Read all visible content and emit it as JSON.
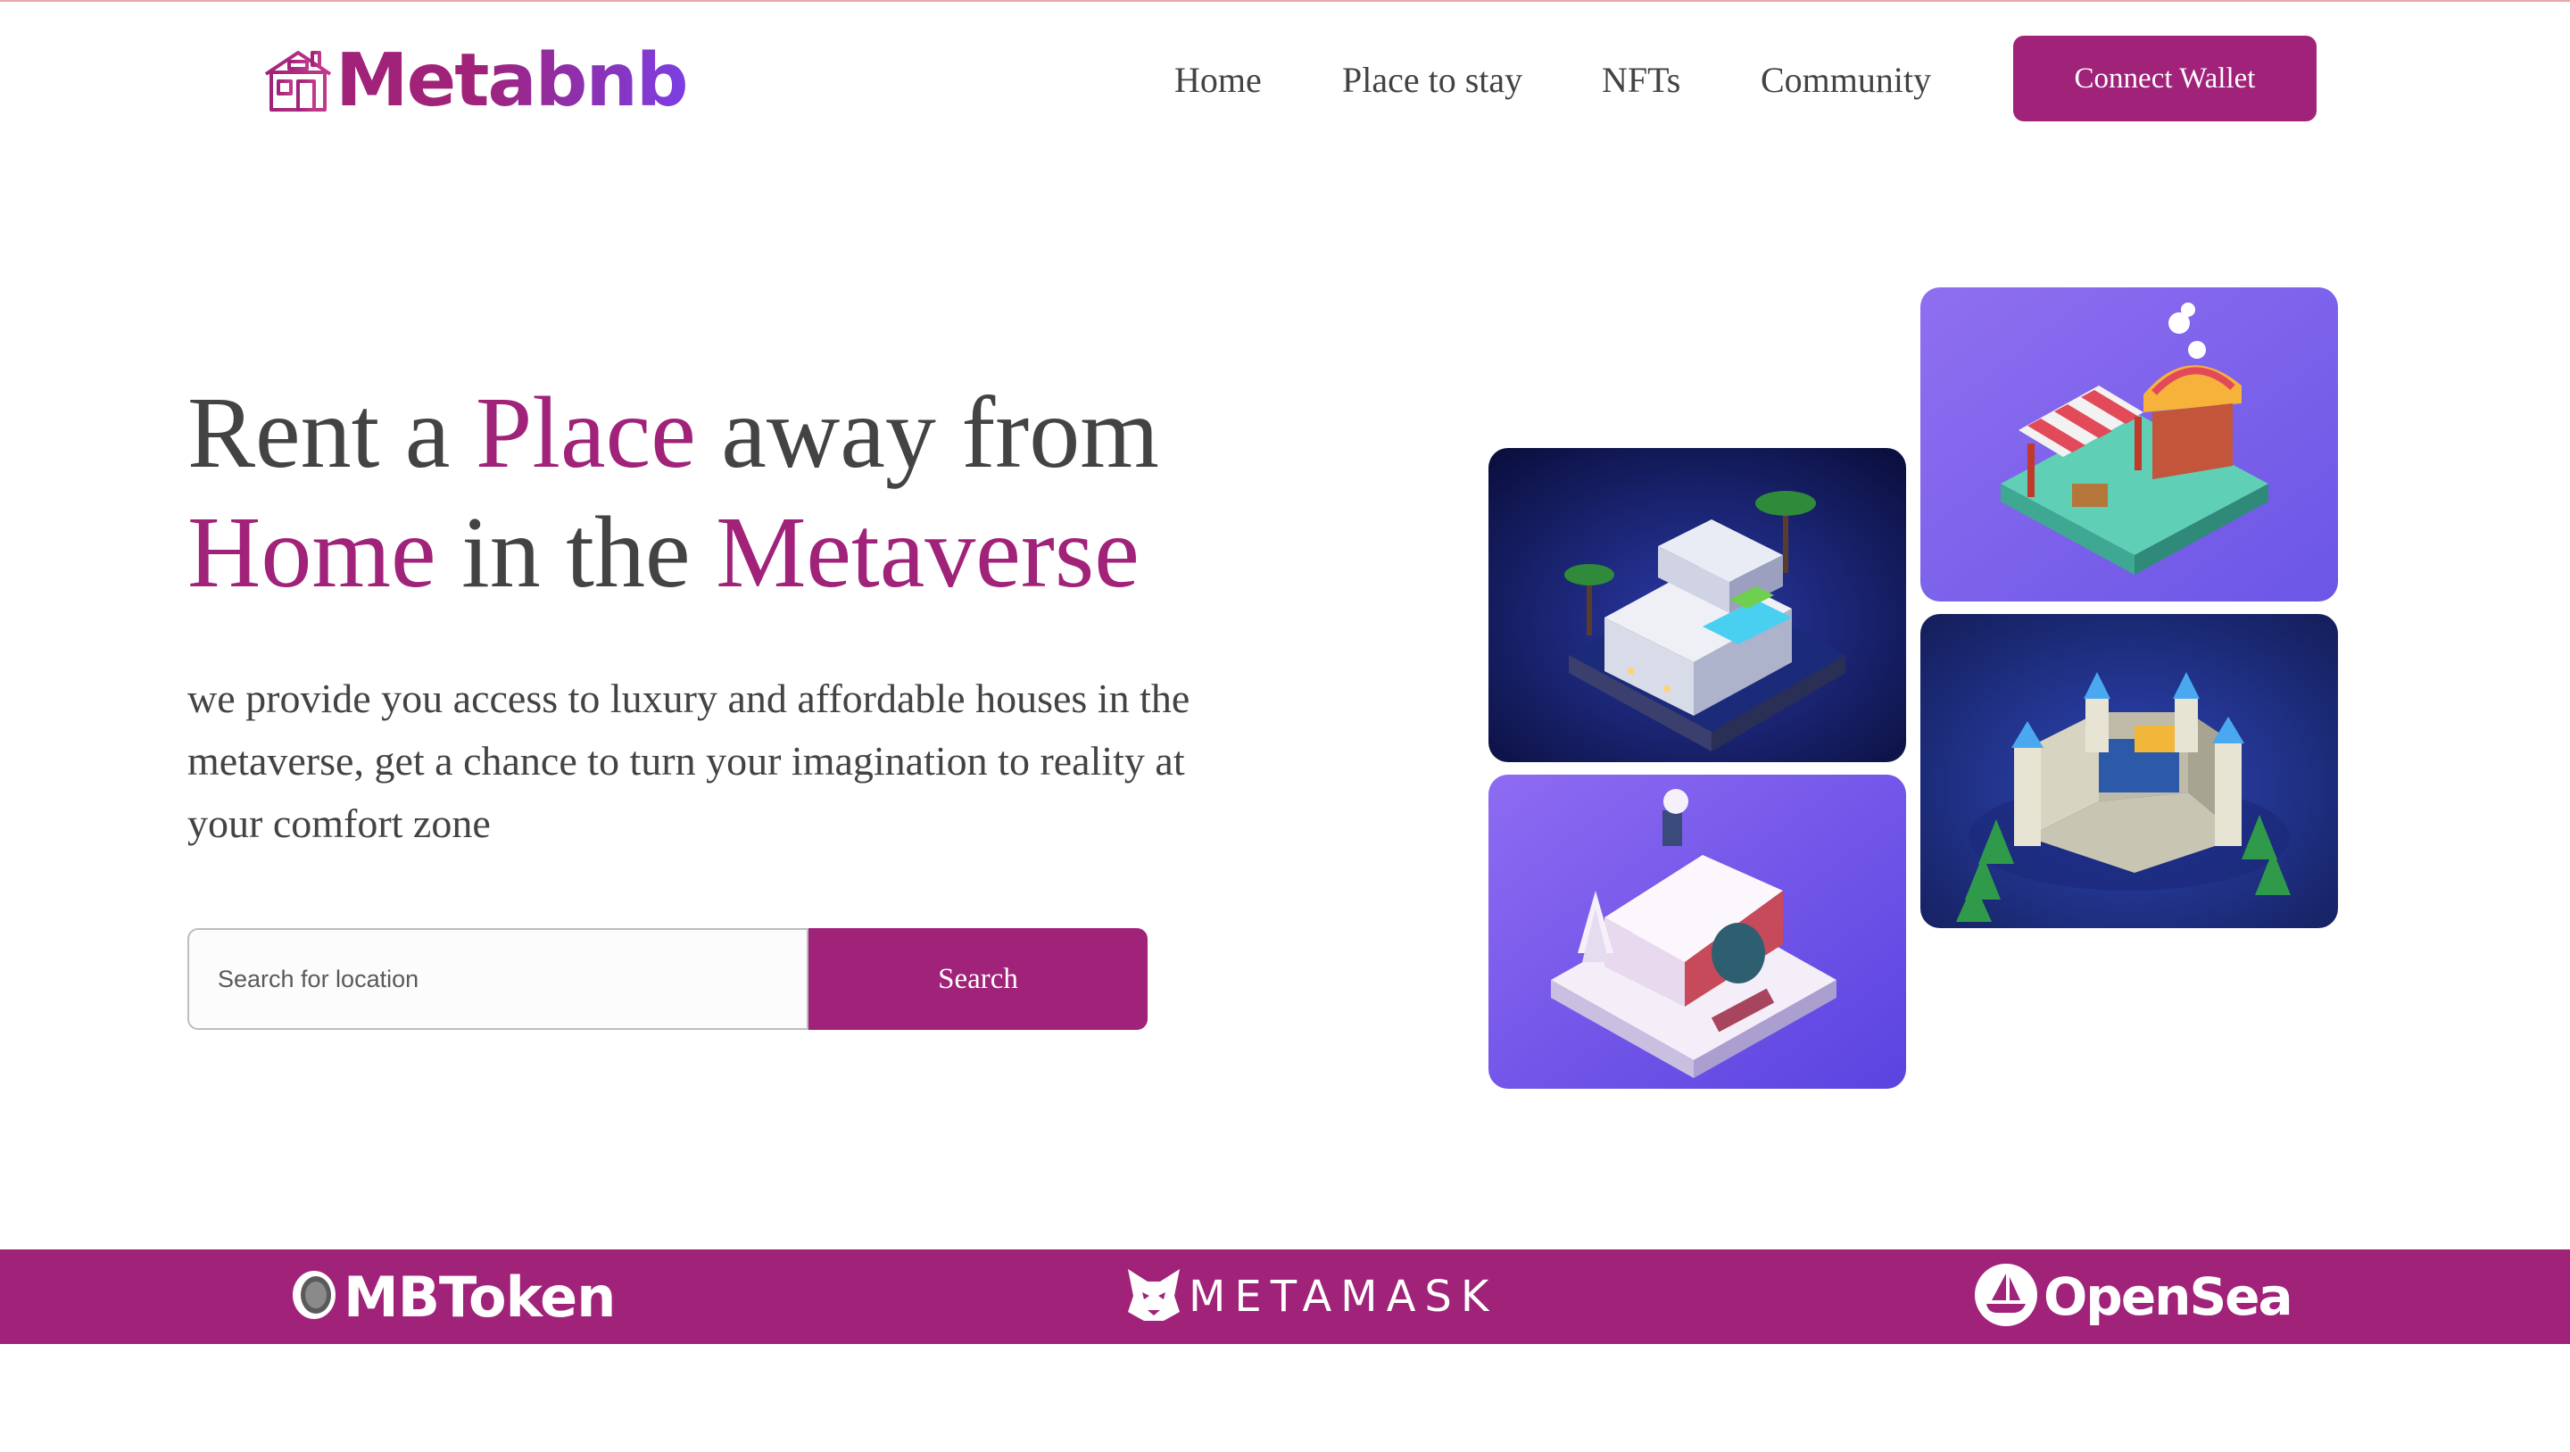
{
  "brand": {
    "name": "Metabnb",
    "gradient_start": "#A02279",
    "gradient_end": "#7B3FE4"
  },
  "nav": {
    "items": [
      {
        "label": "Home"
      },
      {
        "label": "Place to stay"
      },
      {
        "label": "NFTs"
      },
      {
        "label": "Community"
      }
    ],
    "cta_label": "Connect Wallet"
  },
  "hero": {
    "title_parts": [
      "Rent a ",
      "Place",
      " away from",
      "Home",
      " in the ",
      "Metaverse"
    ],
    "subtitle": "we provide you access to luxury and affordable houses in the metaverse, get a chance to turn your imagination to reality at your comfort zone",
    "search": {
      "placeholder": "Search for location",
      "value": "",
      "button_label": "Search"
    }
  },
  "gallery": [
    {
      "name": "modern-villa-image",
      "icon": "villa-icon"
    },
    {
      "name": "snow-cottage-image",
      "icon": "cottage-icon"
    },
    {
      "name": "market-stall-image",
      "icon": "market-icon"
    },
    {
      "name": "castle-image",
      "icon": "castle-icon"
    }
  ],
  "partners": [
    {
      "name": "MBToken",
      "icon": "mbtoken-icon"
    },
    {
      "name": "METAMASK",
      "icon": "fox-icon"
    },
    {
      "name": "OpenSea",
      "icon": "sailboat-icon"
    }
  ],
  "colors": {
    "accent": "#A02279",
    "text": "#434343",
    "background": "#FFFFFF"
  }
}
